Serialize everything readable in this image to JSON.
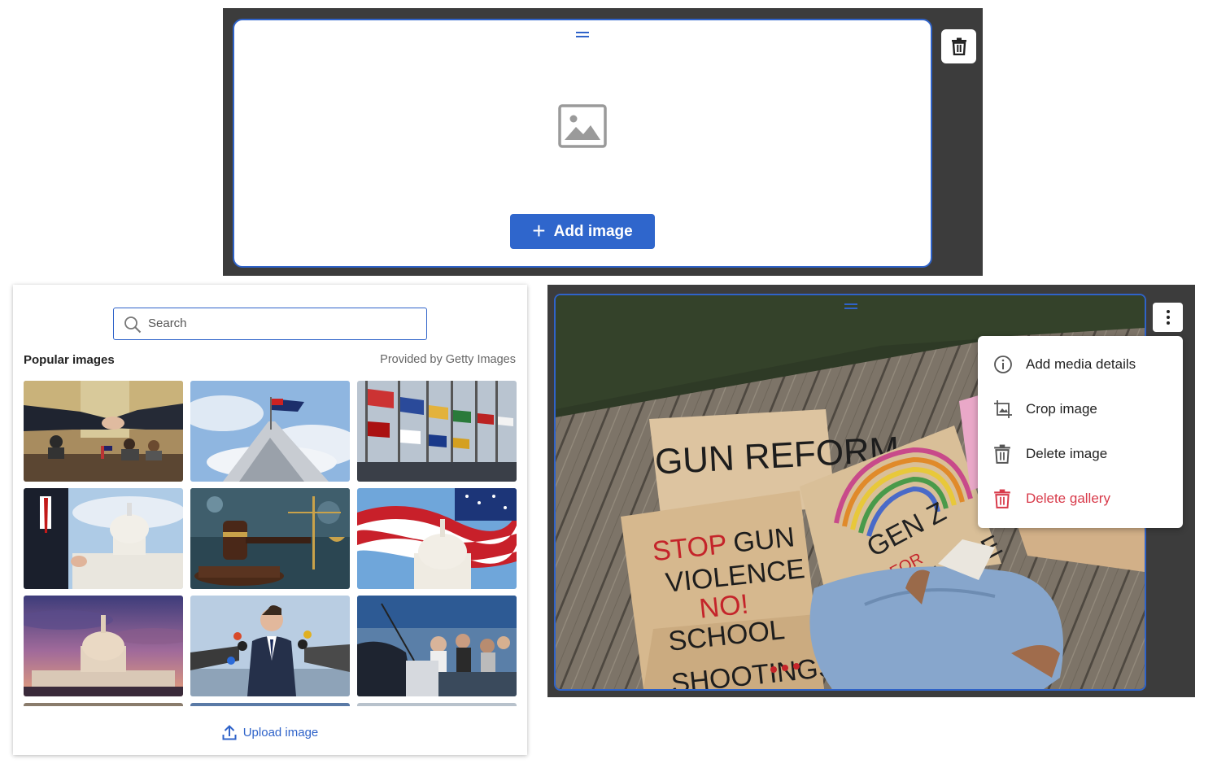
{
  "empty_block": {
    "add_image_label": "Add image",
    "icons": {
      "drag": "drag-handle-icon",
      "placeholder": "image-placeholder-icon",
      "plus": "plus-icon",
      "trash": "trash-icon"
    },
    "accent_color": "#2f66cc"
  },
  "picker": {
    "search_placeholder": "Search",
    "search_value": "",
    "popular_label": "Popular images",
    "provider_label": "Provided by Getty Images",
    "upload_label": "Upload image",
    "thumbnails": [
      "Handshake at conference table with flags",
      "Australian flag on Parliament House",
      "Row of international flags",
      "Capitol building with man in suit",
      "Judge gavel and scales of justice",
      "Capitol dome with US flag",
      "Capitol building at sunset",
      "Politician with reporters' microphones",
      "Speaker at podium with audience"
    ]
  },
  "photo_block": {
    "sign_texts": [
      "GUN REFORM",
      "STOP GUN VIOLENCE NO! SCHOOL SHOOTINGS",
      "GEN Z FOR CHANGE"
    ],
    "menu": {
      "items": [
        {
          "label": "Add media details",
          "icon": "info-icon",
          "danger": false
        },
        {
          "label": "Crop image",
          "icon": "crop-icon",
          "danger": false
        },
        {
          "label": "Delete image",
          "icon": "trash-icon",
          "danger": false
        },
        {
          "label": "Delete gallery",
          "icon": "trash-icon",
          "danger": true
        }
      ]
    },
    "danger_color": "#d83a4a"
  }
}
